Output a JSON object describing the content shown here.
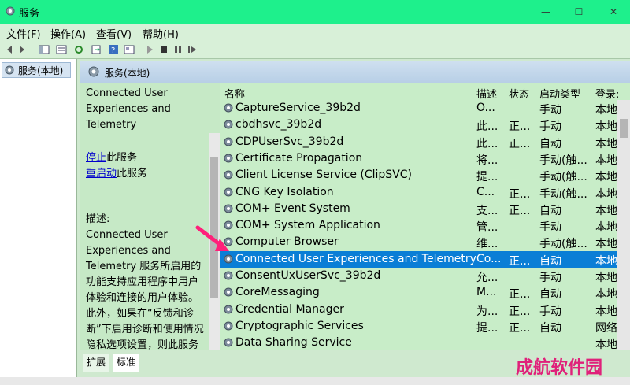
{
  "window": {
    "title": "服务"
  },
  "menu": [
    "文件(F)",
    "操作(A)",
    "查看(V)",
    "帮助(H)"
  ],
  "toolbar_icons": [
    "back-icon",
    "forward-icon",
    "console-tree-icon",
    "list-icon",
    "refresh-icon",
    "export-icon",
    "help-icon",
    "properties-icon",
    "play-icon",
    "stop-icon",
    "pause-icon",
    "restart-icon"
  ],
  "left": {
    "item": "服务(本地)"
  },
  "header": {
    "label": "服务(本地)"
  },
  "desc": {
    "name": [
      "Connected User",
      "Experiences and",
      "Telemetry"
    ],
    "stop": "停止",
    "stop_suffix": "此服务",
    "restart": "重启动",
    "restart_suffix": "此服务",
    "desc_label": "描述:",
    "lines": [
      "Connected User",
      "Experiences and",
      "Telemetry 服务所启用的",
      "功能支持应用程序中用户",
      "体验和连接的用户体验。",
      "此外，如果在“反馈和诊",
      "断”下启用诊断和使用情况",
      "隐私选项设置，则此服务"
    ]
  },
  "columns": [
    "名称",
    "描述",
    "状态",
    "启动类型",
    "登录:"
  ],
  "rows": [
    {
      "name": "CaptureService_39b2d",
      "desc": "O...",
      "status": "",
      "startup": "手动",
      "logon": "本地."
    },
    {
      "name": "cbdhsvc_39b2d",
      "desc": "此...",
      "status": "正...",
      "startup": "手动",
      "logon": "本地."
    },
    {
      "name": "CDPUserSvc_39b2d",
      "desc": "此...",
      "status": "正...",
      "startup": "自动",
      "logon": "本地."
    },
    {
      "name": "Certificate Propagation",
      "desc": "将...",
      "status": "",
      "startup": "手动(触...",
      "logon": "本地."
    },
    {
      "name": "Client License Service (ClipSVC)",
      "desc": "提...",
      "status": "",
      "startup": "手动(触...",
      "logon": "本地."
    },
    {
      "name": "CNG Key Isolation",
      "desc": "C...",
      "status": "正...",
      "startup": "手动(触...",
      "logon": "本地."
    },
    {
      "name": "COM+ Event System",
      "desc": "支...",
      "status": "正...",
      "startup": "自动",
      "logon": "本地."
    },
    {
      "name": "COM+ System Application",
      "desc": "管...",
      "status": "",
      "startup": "手动",
      "logon": "本地."
    },
    {
      "name": "Computer Browser",
      "desc": "维...",
      "status": "",
      "startup": "手动(触...",
      "logon": "本地."
    },
    {
      "name": "Connected User Experiences and Telemetry",
      "desc": "Co...",
      "status": "正...",
      "startup": "自动",
      "logon": "本地.",
      "selected": true
    },
    {
      "name": "ConsentUxUserSvc_39b2d",
      "desc": "允...",
      "status": "",
      "startup": "手动",
      "logon": "本地."
    },
    {
      "name": "CoreMessaging",
      "desc": "M...",
      "status": "正...",
      "startup": "自动",
      "logon": "本地."
    },
    {
      "name": "Credential Manager",
      "desc": "为...",
      "status": "正...",
      "startup": "手动",
      "logon": "本地."
    },
    {
      "name": "Cryptographic Services",
      "desc": "提...",
      "status": "正...",
      "startup": "自动",
      "logon": "网络."
    },
    {
      "name": "Data Sharing Service",
      "desc": "",
      "status": "",
      "startup": "",
      "logon": "本地."
    }
  ],
  "tabs": [
    "扩展",
    "标准"
  ],
  "watermark": "成航软件园"
}
